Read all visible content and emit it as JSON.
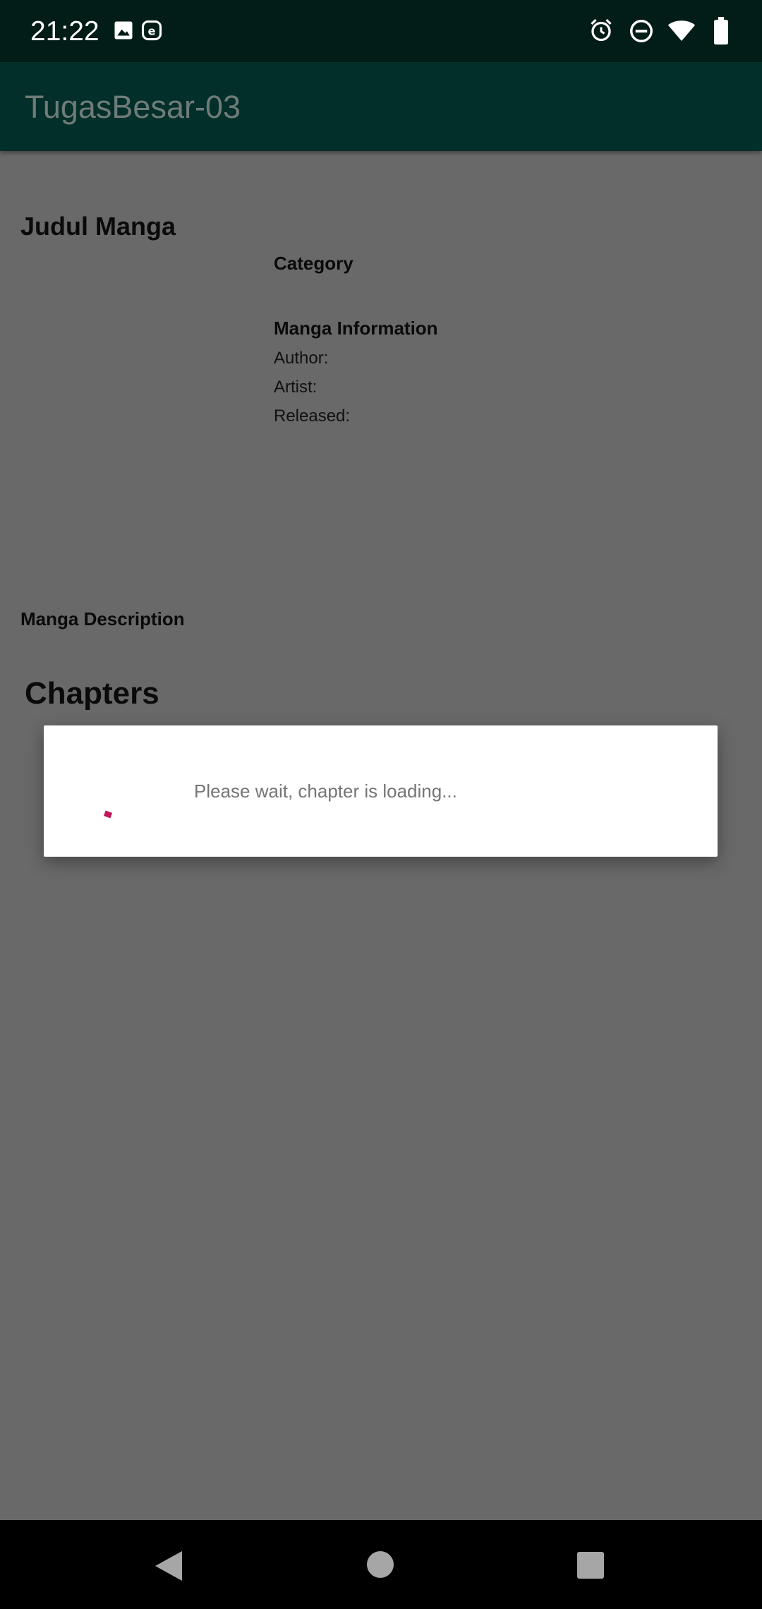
{
  "status_bar": {
    "time": "21:22",
    "left_icons": [
      "image-icon",
      "e-notification-icon"
    ],
    "right_icons": [
      "alarm-icon",
      "do-not-disturb-icon",
      "wifi-icon",
      "battery-icon"
    ]
  },
  "app_bar": {
    "title": "TugasBesar-03"
  },
  "content": {
    "manga_title": "Judul Manga",
    "category_heading": "Category",
    "info_heading": "Manga Information",
    "author_label": "Author:",
    "artist_label": "Artist:",
    "released_label": "Released:",
    "description_heading": "Manga Description",
    "chapters_heading": "Chapters"
  },
  "dialog": {
    "message": "Please wait, chapter is loading..."
  },
  "nav_bar": {
    "buttons": [
      "back-icon",
      "home-icon",
      "recents-icon"
    ]
  },
  "colors": {
    "status_bar_bg": "#021c17",
    "app_bar_bg": "#022f29",
    "scrim_bg": "#696969",
    "spinner_accent": "#c2185b"
  }
}
